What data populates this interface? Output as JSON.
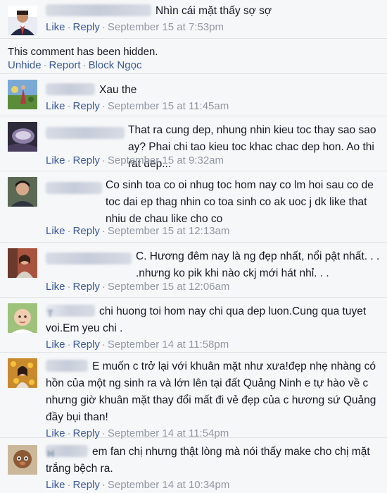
{
  "labels": {
    "like": "Like",
    "reply": "Reply",
    "dot": "·"
  },
  "hidden": {
    "text": "This comment has been hidden.",
    "unhide": "Unhide",
    "report": "Report",
    "block": "Block Ngọc"
  },
  "comments": [
    {
      "text": "Nhìn cái mặt thấy sợ sợ",
      "date": "September 15 at 7:53pm"
    },
    {
      "text": "Xau the",
      "date": "September 15 at 11:45am"
    },
    {
      "text": "That ra cung dep, nhung nhin kieu toc thay sao sao ay? Phai chi tao kieu toc khac chac dep hon. Ao thi rat dep...",
      "date": "September 15 at 9:32am"
    },
    {
      "text": "Co sinh toa co oi nhug toc hom nay co lm hoi sau co de toc dai ep thag nhin co toa sinh co ak uoc j dk like that nhiu de chau like cho co",
      "date": "September 15 at 12:13am"
    },
    {
      "text": "C. Hương đêm nay là ng đẹp nhất, nổi pật nhất. . . .nhưng ko pik khi nào ckj mới hát nhỉ. . .",
      "date": "September 15 at 12:06am"
    },
    {
      "initial": "T",
      "text": "chi huong toi hom nay chi qua dep luon.Cung qua tuyet voi.Em yeu chi .",
      "date": "September 14 at 11:58pm"
    },
    {
      "text": "E muốn c trở lại với khuân mặt như xưa!đẹp nhẹ nhàng có hồn của một ng sinh ra và lớn lên tại đất Quảng Ninh e tự hào về c nhưng giờ khuân mặt thay đổi mất đi vẻ đẹp của c hương sứ Quảng đầy bụi than!",
      "date": "September 14 at 11:54pm"
    },
    {
      "initial": "H",
      "text": "em fan chị nhưng thật lòng mà nói thấy make cho chị mặt trắng bệch ra.",
      "date": "September 14 at 10:34pm"
    }
  ]
}
